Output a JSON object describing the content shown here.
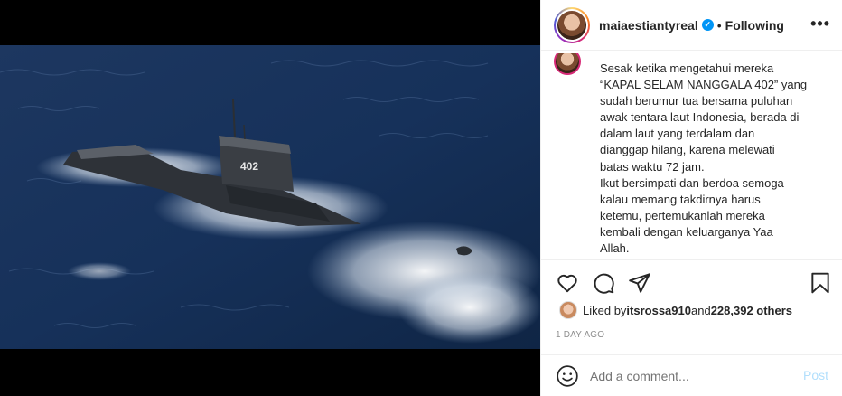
{
  "post": {
    "username": "maiaestiantyreal",
    "verified_icon": "verified-badge-icon",
    "separator": "•",
    "follow_status": "Following",
    "more_label": "•••",
    "caption": "Sesak ketika mengetahui mereka\n“KAPAL SELAM NANGGALA 402” yang\nsudah berumur tua bersama puluhan\nawak tentara laut Indonesia, berada di\ndalam laut yang terdalam dan\ndianggap hilang, karena melewati\nbatas waktu 72 jam.\nIkut bersimpati dan berdoa semoga\nkalau memang takdirnya harus\nketemu, pertemukanlah mereka\nkembali dengan keluarganya Yaa\nAllah.",
    "image_text": "402",
    "likes": {
      "prefix": "Liked by ",
      "liker": "itsrossa910",
      "middle": " and ",
      "others": "228,392 others"
    },
    "timestamp": "1 day ago",
    "comment_placeholder": "Add a comment...",
    "post_label": "Post"
  },
  "icons": [
    "heart-icon",
    "comment-icon",
    "share-icon",
    "bookmark-icon",
    "emoji-icon"
  ],
  "colors": {
    "link_blue": "#0095f6",
    "post_disabled": "#b2dffc",
    "muted": "#8e8e8e"
  }
}
